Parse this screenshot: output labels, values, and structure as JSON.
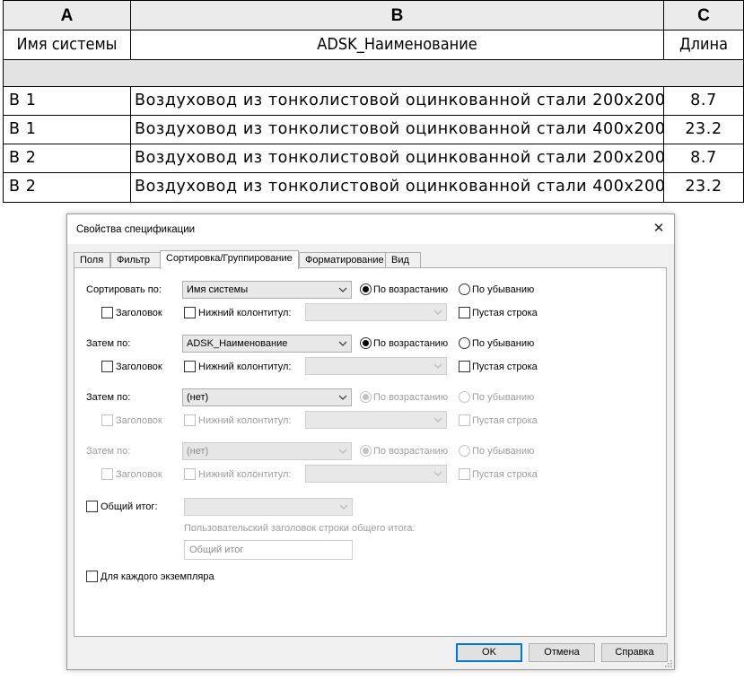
{
  "schedule": {
    "column_letters": [
      "A",
      "B",
      "C"
    ],
    "column_headers": [
      "Имя системы",
      "ADSK_Наименование",
      "Длина"
    ],
    "rows": [
      {
        "system": "B 1",
        "name": "Воздуховод из тонколистовой оцинкованной стали 200x200",
        "length": "8.7"
      },
      {
        "system": "B 1",
        "name": "Воздуховод из тонколистовой оцинкованной стали 400x200",
        "length": "23.2"
      },
      {
        "system": "B 2",
        "name": "Воздуховод из тонколистовой оцинкованной стали 200x200",
        "length": "8.7"
      },
      {
        "system": "B 2",
        "name": "Воздуховод из тонколистовой оцинкованной стали 400x200",
        "length": "23.2"
      }
    ]
  },
  "dialog": {
    "title": "Свойства спецификации",
    "close_icon": "close-icon",
    "tabs": [
      "Поля",
      "Фильтр",
      "Сортировка/Группирование",
      "Форматирование",
      "Вид"
    ],
    "active_tab": "Сортировка/Группирование",
    "sort_rows": [
      {
        "label": "Сортировать по:",
        "value": "Имя системы",
        "ascending": "По возрастанию",
        "descending": "По убыванию",
        "header": "Заголовок",
        "footer": "Нижний колонтитул:",
        "blank": "Пустая строка"
      },
      {
        "label": "Затем по:",
        "value": "ADSK_Наименование",
        "ascending": "По возрастанию",
        "descending": "По убыванию",
        "header": "Заголовок",
        "footer": "Нижний колонтитул:",
        "blank": "Пустая строка"
      },
      {
        "label": "Затем по:",
        "value": "(нет)",
        "ascending": "По возрастанию",
        "descending": "По убыванию",
        "header": "Заголовок",
        "footer": "Нижний колонтитул:",
        "blank": "Пустая строка"
      },
      {
        "label": "Затем по:",
        "value": "(нет)",
        "ascending": "По возрастанию",
        "descending": "По убыванию",
        "header": "Заголовок",
        "footer": "Нижний колонтитул:",
        "blank": "Пустая строка"
      }
    ],
    "grand_total": {
      "label": "Общий итог:",
      "custom_title_label": "Пользовательский заголовок строки общего итога:",
      "custom_title_value": "Общий итог"
    },
    "itemize": "Для каждого экземпляра",
    "buttons": {
      "ok": "OK",
      "cancel": "Отмена",
      "help": "Справка"
    }
  }
}
